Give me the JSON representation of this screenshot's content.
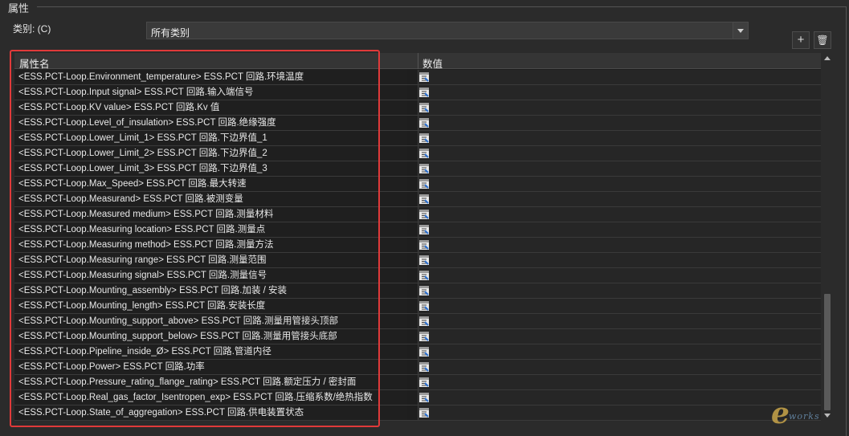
{
  "group_title": "属性",
  "category": {
    "label": "类别: (C)",
    "selected": "所有类别"
  },
  "toolbar": {
    "add_glyph": "+",
    "delete_glyph": "🗑"
  },
  "grid": {
    "columns": [
      "属性名",
      "数值"
    ],
    "rows": [
      "<ESS.PCT-Loop.Environment_temperature> ESS.PCT 回路.环境温度",
      "<ESS.PCT-Loop.Input signal> ESS.PCT 回路.输入端信号",
      "<ESS.PCT-Loop.KV value> ESS.PCT 回路.Kv 值",
      "<ESS.PCT-Loop.Level_of_insulation> ESS.PCT 回路.绝缘强度",
      "<ESS.PCT-Loop.Lower_Limit_1> ESS.PCT 回路.下边界值_1",
      "<ESS.PCT-Loop.Lower_Limit_2> ESS.PCT 回路.下边界值_2",
      "<ESS.PCT-Loop.Lower_Limit_3> ESS.PCT 回路.下边界值_3",
      "<ESS.PCT-Loop.Max_Speed> ESS.PCT 回路.最大转速",
      "<ESS.PCT-Loop.Measurand> ESS.PCT 回路.被测变量",
      "<ESS.PCT-Loop.Measured medium> ESS.PCT 回路.测量材料",
      "<ESS.PCT-Loop.Measuring location> ESS.PCT 回路.测量点",
      "<ESS.PCT-Loop.Measuring method> ESS.PCT 回路.测量方法",
      "<ESS.PCT-Loop.Measuring range> ESS.PCT 回路.测量范围",
      "<ESS.PCT-Loop.Measuring signal> ESS.PCT 回路.测量信号",
      "<ESS.PCT-Loop.Mounting_assembly> ESS.PCT 回路.加装 / 安装",
      "<ESS.PCT-Loop.Mounting_length> ESS.PCT 回路.安装长度",
      "<ESS.PCT-Loop.Mounting_support_above> ESS.PCT 回路.测量用管接头顶部",
      "<ESS.PCT-Loop.Mounting_support_below> ESS.PCT 回路.测量用管接头底部",
      "<ESS.PCT-Loop.Pipeline_inside_Ø> ESS.PCT 回路.管道内径",
      "<ESS.PCT-Loop.Power> ESS.PCT 回路.功率",
      "<ESS.PCT-Loop.Pressure_rating_flange_rating> ESS.PCT 回路.额定压力 / 密封面",
      "<ESS.PCT-Loop.Real_gas_factor_Isentropen_exp> ESS.PCT 回路.压缩系数/绝热指数",
      "<ESS.PCT-Loop.State_of_aggregation> ESS.PCT 回路.供电装置状态"
    ]
  },
  "colors": {
    "highlight": "#e03a3a",
    "background": "#2b2b2b"
  }
}
